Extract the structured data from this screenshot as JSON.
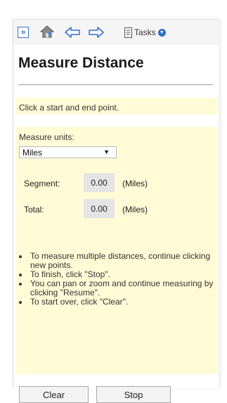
{
  "toolbar": {
    "expand_symbol": "»",
    "tasks_label": "Tasks",
    "accent_color": "#2f6fc5"
  },
  "panel": {
    "title": "Measure Distance",
    "instruction": "Click a start and end point.",
    "units_label": "Measure units:",
    "units_selected": "Miles",
    "segment_label": "Segment:",
    "segment_value": "0.00",
    "segment_unit": "(Miles)",
    "total_label": "Total:",
    "total_value": "0.00",
    "total_unit": "(Miles)",
    "tips": [
      "To measure multiple distances, continue clicking new points.",
      "To finish, click \"Stop\".",
      "You can pan or zoom and continue measuring by clicking \"Resume\".",
      "To start over, click \"Clear\"."
    ]
  },
  "buttons": {
    "clear": "Clear",
    "stop": "Stop"
  },
  "colors": {
    "note_background": "#fffbd6",
    "value_background": "#e4e4e4"
  }
}
